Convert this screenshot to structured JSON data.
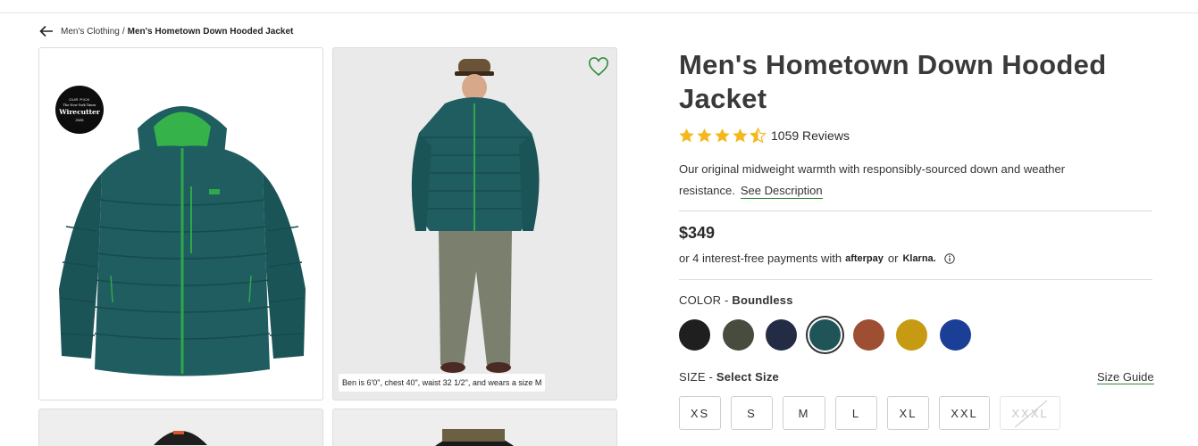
{
  "breadcrumb": {
    "parent": "Men's Clothing",
    "separator": "/",
    "current": "Men's Hometown Down Hooded Jacket"
  },
  "gallery": {
    "badge": {
      "top": "OUR PICK",
      "publisher": "The New York Times",
      "name": "Wirecutter",
      "year": "2025"
    },
    "model_caption": "Ben is 6'0\", chest 40\", waist 32 1/2\", and wears a size M",
    "wishlist_icon": "heart-outline-icon"
  },
  "product": {
    "title": "Men's Hometown Down Hooded Jacket",
    "rating": 4.5,
    "reviews_label": "1059 Reviews",
    "description": "Our original midweight warmth with responsibly-sourced down and weather resistance.",
    "see_description": "See Description",
    "price": "$349",
    "payments": {
      "prefix": "or 4 interest-free payments with",
      "brand1": "afterpay",
      "or": "or",
      "brand2": "Klarna."
    }
  },
  "color": {
    "label": "COLOR -",
    "selected": "Boundless",
    "swatches": [
      "#1f1f1f",
      "#474c3e",
      "#232c44",
      "#1f5559",
      "#9e4e32",
      "#c79a14",
      "#1b3f96"
    ],
    "selected_index": 3
  },
  "size": {
    "label": "SIZE -",
    "selected": "Select Size",
    "guide": "Size Guide",
    "options": [
      {
        "label": "XS",
        "available": true
      },
      {
        "label": "S",
        "available": true
      },
      {
        "label": "M",
        "available": true
      },
      {
        "label": "L",
        "available": true
      },
      {
        "label": "XL",
        "available": true
      },
      {
        "label": "XXL",
        "available": true
      },
      {
        "label": "XXXL",
        "available": false
      }
    ]
  },
  "colors": {
    "accent_green": "#2f8b3a",
    "star": "#f5b81c",
    "jacket": "#1f5d60"
  }
}
